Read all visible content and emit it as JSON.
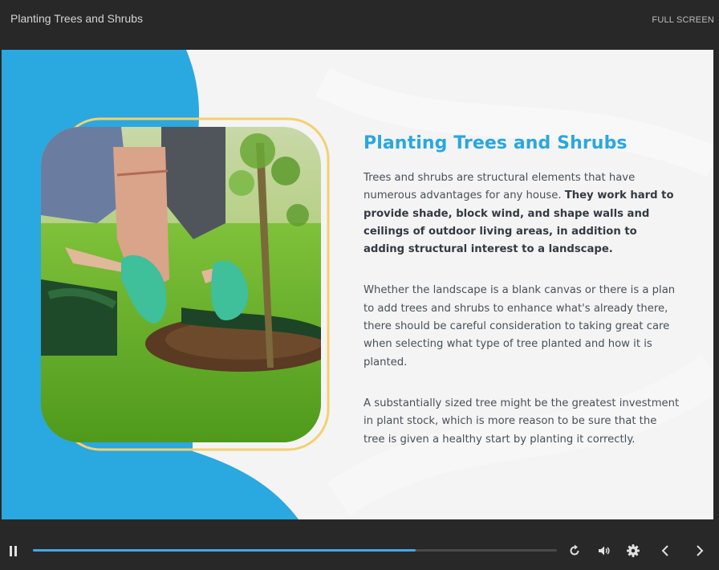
{
  "header": {
    "course_title": "Planting Trees and Shrubs",
    "fullscreen_label": "FULL SCREEN"
  },
  "slide": {
    "heading": "Planting Trees and Shrubs",
    "para1_normal": "Trees and shrubs are structural elements that have numerous advantages for any house. ",
    "para1_bold": "They work hard to provide shade, block wind, and shape walls and ceilings of outdoor living areas, in addition to adding structural interest to a landscape.",
    "para2": "Whether the landscape is a blank canvas or there is a plan to add trees and shrubs to enhance what's already there, there should be careful consideration to taking great care when selecting what type of tree planted and how it is planted.",
    "para3": "A substantially sized tree might be the greatest investment in plant stock, which is more reason to be sure that the tree is given a healthy start by planting it correctly."
  },
  "player": {
    "progress": 0.73,
    "icons": [
      "pause-icon",
      "replay-icon",
      "volume-icon",
      "gear-icon",
      "chevron-left-icon",
      "chevron-right-icon"
    ]
  },
  "colors": {
    "accent_blue": "#2aa7df",
    "frame_yellow": "#f4d06f",
    "progress_blue": "#45a6e6",
    "bar_bg": "#282828"
  }
}
